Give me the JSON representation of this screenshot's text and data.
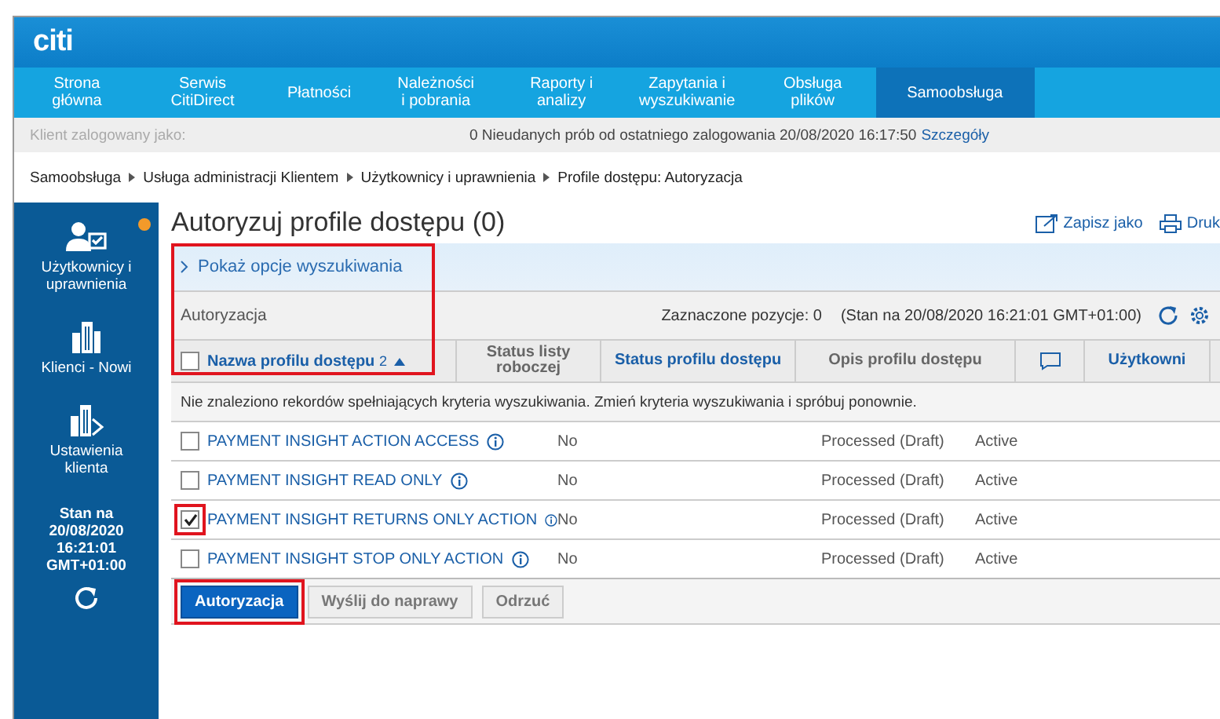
{
  "logo": "citi",
  "nav": [
    {
      "label": "Strona główna",
      "selected": false
    },
    {
      "label": "Serwis CitiDirect",
      "selected": false
    },
    {
      "label": "Płatności",
      "selected": false
    },
    {
      "label": "Należności i pobrania",
      "selected": false
    },
    {
      "label": "Raporty i analizy",
      "selected": false
    },
    {
      "label": "Zapytania i wyszukiwanie",
      "selected": false
    },
    {
      "label": "Obsługa plików",
      "selected": false
    },
    {
      "label": "Samoobsługa",
      "selected": true
    }
  ],
  "info_bar": {
    "client": "Klient zalogowany jako:",
    "attempts": "0 Nieudanych prób od ostatniego zalogowania 20/08/2020 16:17:50",
    "details_link": "Szczegóły"
  },
  "breadcrumb": [
    "Samoobsługa",
    "Usługa administracji Klientem",
    "Użytkownicy i uprawnienia",
    "Profile dostępu: Autoryzacja"
  ],
  "sidebar": {
    "items": [
      {
        "kind": "users",
        "label": "Użytkownicy i uprawnienia",
        "notification": true
      },
      {
        "kind": "clients",
        "label": "Klienci - Nowi",
        "notification": false
      },
      {
        "kind": "settings",
        "label": "Ustawienia klienta",
        "notification": false
      }
    ],
    "status": "Stan na 20/08/2020 16:21:01 GMT+01:00"
  },
  "page_title": "Autoryzuj profile dostępu (0)",
  "actions": [
    "Zapisz jako",
    "Druk"
  ],
  "search_toggle": {
    "label": "Pokaż opcje wyszukiwania",
    "highlighted": true
  },
  "section": {
    "title": "Autoryzacja",
    "selected_count": "Zaznaczone pozycje: 0",
    "as_of": "(Stan na 20/08/2020 16:21:01 GMT+01:00)"
  },
  "table": {
    "select_all_checked": false,
    "columns": [
      {
        "label": "Nazwa profilu dostępu",
        "sort_badge": "2",
        "kind": "link"
      },
      {
        "label": "Status listy roboczej",
        "kind": "plain"
      },
      {
        "label": "Status profilu dostępu",
        "kind": "link"
      },
      {
        "label": "Opis profilu dostępu",
        "kind": "plain"
      },
      {
        "kind": "comment"
      },
      {
        "label": "Użytkowni",
        "kind": "link"
      }
    ],
    "message": "Nie znaleziono rekordów spełniających kryteria wyszukiwania. Zmień kryteria wyszukiwania i spróbuj ponownie.",
    "rows": [
      {
        "name": "PAYMENT INSIGHT ACTION ACCESS",
        "draft": "No",
        "status": "Processed (Draft)",
        "state": "Active",
        "checked": false,
        "highlighted": false
      },
      {
        "name": "PAYMENT INSIGHT READ ONLY",
        "draft": "No",
        "status": "Processed (Draft)",
        "state": "Active",
        "checked": false,
        "highlighted": false
      },
      {
        "name": "PAYMENT INSIGHT RETURNS ONLY ACTION",
        "draft": "No",
        "status": "Processed (Draft)",
        "state": "Active",
        "checked": true,
        "highlighted": true
      },
      {
        "name": "PAYMENT INSIGHT STOP ONLY ACTION",
        "draft": "No",
        "status": "Processed (Draft)",
        "state": "Active",
        "checked": false,
        "highlighted": false
      }
    ]
  },
  "buttons": [
    {
      "label": "Autoryzacja",
      "kind": "primary",
      "highlighted": true
    },
    {
      "label": "Wyślij do naprawy",
      "kind": "secondary",
      "highlighted": false
    },
    {
      "label": "Odrzuć",
      "kind": "secondary",
      "highlighted": false
    }
  ]
}
